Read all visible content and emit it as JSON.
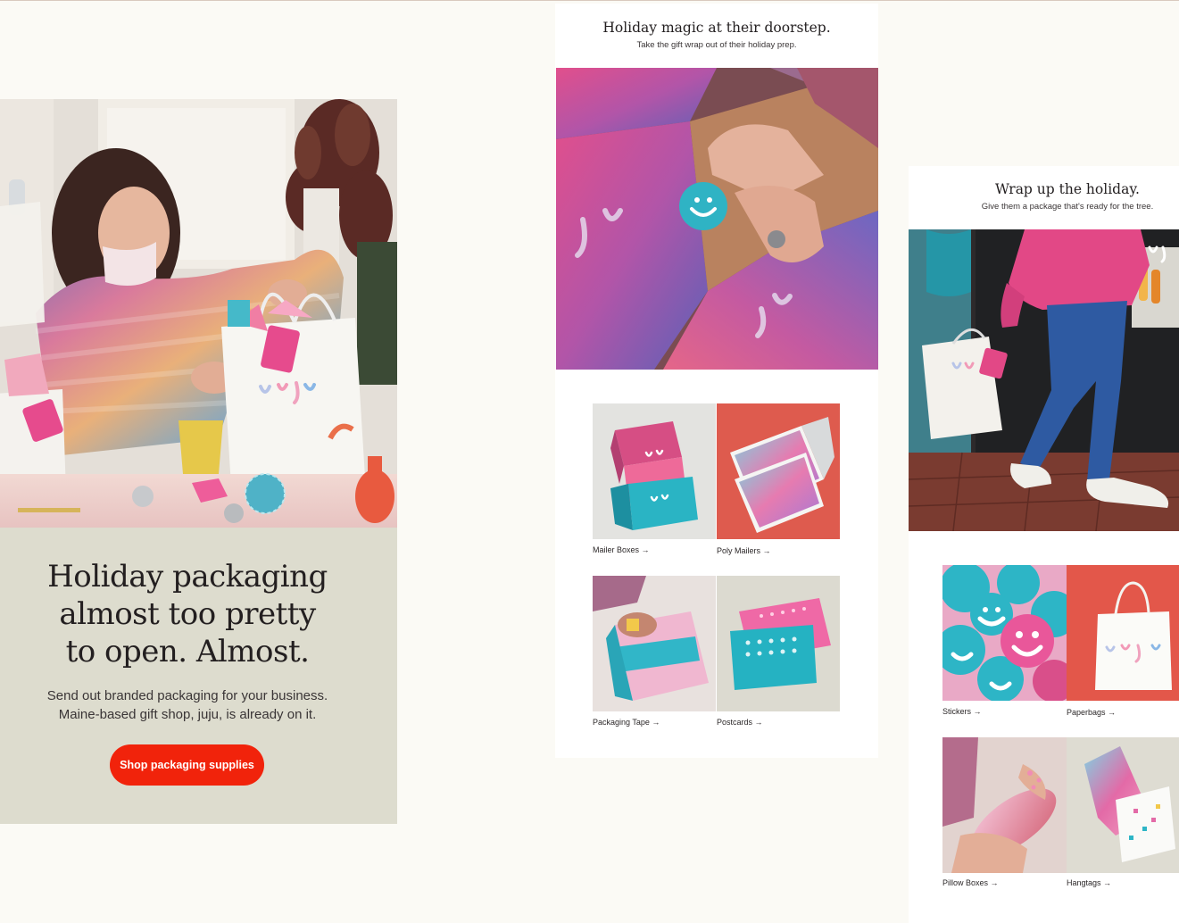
{
  "panel_left": {
    "headline": [
      "Holiday packaging",
      "almost too pretty",
      "to open. Almost."
    ],
    "body": [
      "Send out branded packaging for your business.",
      "Maine-based gift shop, juju, is already on it."
    ],
    "cta_label": "Shop packaging supplies",
    "tag_text": "juju"
  },
  "panel_middle": {
    "title": "Holiday magic at their doorstep.",
    "subtitle": "Take the gift wrap out of their holiday prep.",
    "products": [
      {
        "label": "Mailer Boxes →"
      },
      {
        "label": "Poly Mailers →"
      },
      {
        "label": "Packaging Tape →"
      },
      {
        "label": "Postcards →"
      }
    ]
  },
  "panel_right": {
    "title": "Wrap up the holiday.",
    "subtitle": "Give them a package that's ready for the tree.",
    "products": [
      {
        "label": "Stickers →"
      },
      {
        "label": "Paperbags →"
      },
      {
        "label": "Pillow Boxes →"
      },
      {
        "label": "Hangtags →"
      }
    ]
  },
  "colors": {
    "background": "#fbfaf5",
    "cta": "#f1230b",
    "panel_left_bg": "#dddcce",
    "brand_pink": "#e84b8a",
    "brand_teal": "#27aec1"
  }
}
